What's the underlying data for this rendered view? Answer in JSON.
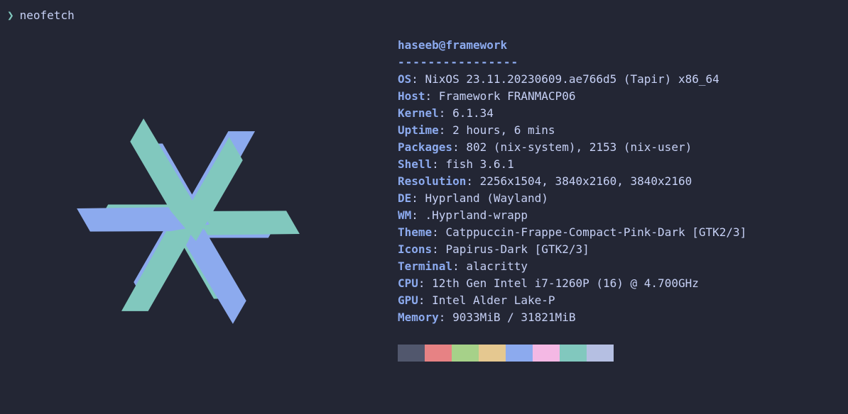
{
  "prompt": {
    "symbol": "❯",
    "command": "neofetch"
  },
  "header": {
    "user": "haseeb",
    "at": "@",
    "host": "framework"
  },
  "separator": "----------------",
  "info": [
    {
      "key": "OS",
      "value": "NixOS 23.11.20230609.ae766d5 (Tapir) x86_64"
    },
    {
      "key": "Host",
      "value": "Framework FRANMACP06"
    },
    {
      "key": "Kernel",
      "value": "6.1.34"
    },
    {
      "key": "Uptime",
      "value": "2 hours, 6 mins"
    },
    {
      "key": "Packages",
      "value": "802 (nix-system), 2153 (nix-user)"
    },
    {
      "key": "Shell",
      "value": "fish 3.6.1"
    },
    {
      "key": "Resolution",
      "value": "2256x1504, 3840x2160, 3840x2160"
    },
    {
      "key": "DE",
      "value": "Hyprland (Wayland)"
    },
    {
      "key": "WM",
      "value": ".Hyprland-wrapp"
    },
    {
      "key": "Theme",
      "value": "Catppuccin-Frappe-Compact-Pink-Dark [GTK2/3]"
    },
    {
      "key": "Icons",
      "value": "Papirus-Dark [GTK2/3]"
    },
    {
      "key": "Terminal",
      "value": "alacritty"
    },
    {
      "key": "CPU",
      "value": "12th Gen Intel i7-1260P (16) @ 4.700GHz"
    },
    {
      "key": "GPU",
      "value": "Intel Alder Lake-P"
    },
    {
      "key": "Memory",
      "value": "9033MiB / 31821MiB"
    }
  ],
  "colors": {
    "logo_blue": "#8caaee",
    "logo_teal": "#81c8be",
    "palette": [
      "#51576d",
      "#e78284",
      "#a6d189",
      "#e5c890",
      "#8caaee",
      "#f4b8e4",
      "#81c8be",
      "#b5bfe2"
    ]
  }
}
